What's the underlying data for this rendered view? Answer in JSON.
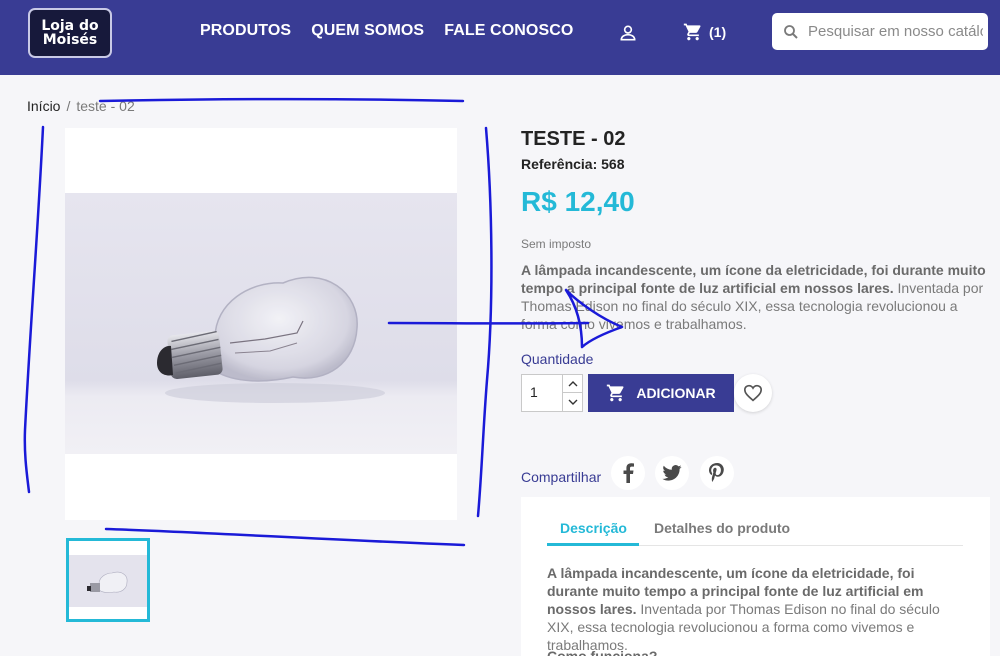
{
  "header": {
    "logo_line1": "Loja do",
    "logo_line2": "Moisés",
    "nav": [
      "PRODUTOS",
      "QUEM SOMOS",
      "FALE CONOSCO"
    ],
    "cart_count": "(1)",
    "search_placeholder": "Pesquisar em nosso catálogo",
    "icons": [
      "user-icon",
      "cart-icon",
      "search-icon"
    ],
    "bg_color": "#393c94"
  },
  "breadcrumb": {
    "home": "Início",
    "separator": "/",
    "current": "teste - 02"
  },
  "product": {
    "title": "TESTE - 02",
    "reference": "Referência: 568",
    "price": "R$ 12,40",
    "tax_note": "Sem imposto",
    "desc_bold": "A lâmpada incandescente, um ícone da eletricidade, foi durante muito tempo a principal fonte de luz artificial em nossos lares.",
    "desc_rest": " Inventada por Thomas Edison no final do século XIX, essa tecnologia revolucionou a forma como vivemos e trabalhamos.",
    "quantity_label": "Quantidade",
    "quantity_value": "1",
    "add_button": "ADICIONAR",
    "share_label": "Compartilhar",
    "social_icons": [
      "facebook-icon",
      "twitter-icon",
      "pinterest-icon"
    ],
    "price_color": "#24b9d7"
  },
  "tabs": {
    "items": [
      "Descrição",
      "Detalhes do produto"
    ],
    "active": "Descrição",
    "text_bold": "A lâmpada incandescente, um ícone da eletricidade, foi durante muito tempo a principal fonte de luz artificial em nossos lares.",
    "text_rest": " Inventada por Thomas Edison no final do século XIX, essa tecnologia revolucionou a forma como vivemos e trabalhamos.",
    "subheading": "Como funciona?"
  },
  "annotation_color": "#1a1ad8"
}
